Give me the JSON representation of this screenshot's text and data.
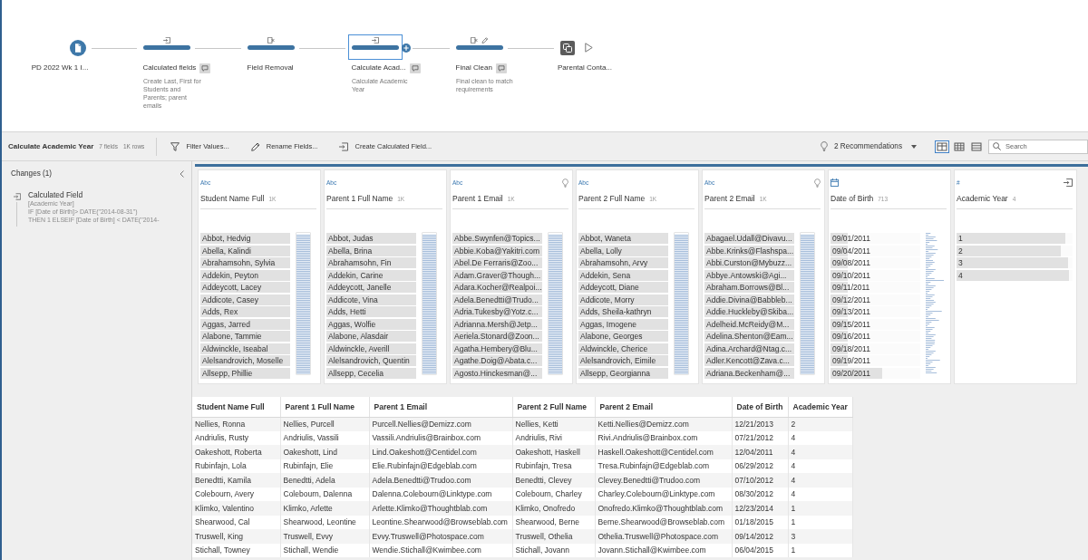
{
  "flow": {
    "nodes": [
      {
        "kind": "input",
        "label": "PD 2022 Wk 1 I...",
        "selected": false,
        "has_comment": false
      },
      {
        "kind": "clean",
        "label": "Calculated fields",
        "change_icons": [
          {
            "kind": "calculation"
          }
        ],
        "selected": false,
        "has_comment": true,
        "description": "Create Last, First for Students and Parents; parent emails"
      },
      {
        "kind": "clean",
        "label": "Field Removal",
        "change_icons": [
          {
            "kind": "remove"
          }
        ],
        "selected": false,
        "has_comment": false
      },
      {
        "kind": "clean",
        "label": "Calculate Acad...",
        "change_icons": [
          {
            "kind": "calculation"
          }
        ],
        "selected": true,
        "has_comment": true,
        "description": "Calculate Academic Year"
      },
      {
        "kind": "clean",
        "label": "Final Clean",
        "change_icons": [
          {
            "kind": "remove"
          },
          {
            "kind": "rename"
          }
        ],
        "selected": false,
        "has_comment": true,
        "description": "Final clean to match requirements"
      },
      {
        "kind": "output",
        "label": "Parental Conta...",
        "selected": false,
        "has_comment": false
      }
    ]
  },
  "toolbar": {
    "title": "Calculate Academic Year",
    "field_count": "7 fields",
    "row_count": "1K rows",
    "actions": [
      {
        "kind": "filter",
        "label": "Filter Values..."
      },
      {
        "kind": "rename",
        "label": "Rename Fields..."
      },
      {
        "kind": "calculation",
        "label": "Create Calculated Field..."
      }
    ],
    "recommendations": "2 Recommendations",
    "view_modes": [
      {
        "kind": "profile",
        "selected": true
      },
      {
        "kind": "table",
        "selected": false
      },
      {
        "kind": "list",
        "selected": false
      }
    ],
    "search": {
      "placeholder": "Search"
    }
  },
  "changes_panel": {
    "title": "Changes (1)",
    "items": [
      {
        "kind": "calculation",
        "title": "Calculated Field",
        "field": "[Academic Year]",
        "formula_lines": [
          "IF [Date of Birth]> DATE(\"2014-08-31\")",
          "THEN 1 ELSEIF [Date of Birth] < DATE(\"2014-"
        ]
      }
    ]
  },
  "profile_cards": [
    {
      "kind": "text",
      "type_label": "Abc",
      "name": "Student Name Full",
      "count": "1K",
      "recommendation": false,
      "calculated": false,
      "values": [
        {
          "label": "Abbot, Hedvig",
          "level": 1
        },
        {
          "label": "Abella, Kalindi",
          "level": 1
        },
        {
          "label": "Abrahamsohn, Sylvia",
          "level": 1
        },
        {
          "label": "Addekin, Peyton",
          "level": 1
        },
        {
          "label": "Addeycott, Lacey",
          "level": 1
        },
        {
          "label": "Addicote, Casey",
          "level": 1
        },
        {
          "label": "Adds, Rex",
          "level": 1
        },
        {
          "label": "Aggas, Jarred",
          "level": 1
        },
        {
          "label": "Alabone, Tammie",
          "level": 1
        },
        {
          "label": "Aldwinckle, Iseabal",
          "level": 1
        },
        {
          "label": "Alelsandrovich, Moselle",
          "level": 1
        },
        {
          "label": "Allsepp, Phillie",
          "level": 1
        }
      ]
    },
    {
      "kind": "text",
      "type_label": "Abc",
      "name": "Parent 1 Full Name",
      "count": "1K",
      "recommendation": false,
      "calculated": false,
      "values": [
        {
          "label": "Abbot, Judas",
          "level": 1
        },
        {
          "label": "Abella, Brina",
          "level": 1
        },
        {
          "label": "Abrahamsohn, Fin",
          "level": 1
        },
        {
          "label": "Addekin, Carine",
          "level": 1
        },
        {
          "label": "Addeycott, Janelle",
          "level": 1
        },
        {
          "label": "Addicote, Vina",
          "level": 1
        },
        {
          "label": "Adds, Hetti",
          "level": 1
        },
        {
          "label": "Aggas, Wolfie",
          "level": 1
        },
        {
          "label": "Alabone, Alasdair",
          "level": 1
        },
        {
          "label": "Aldwinckle, Averill",
          "level": 1
        },
        {
          "label": "Alelsandrovich, Quentin",
          "level": 1
        },
        {
          "label": "Allsepp, Cecelia",
          "level": 1
        }
      ]
    },
    {
      "kind": "text",
      "type_label": "Abc",
      "name": "Parent 1 Email",
      "count": "1K",
      "recommendation": true,
      "calculated": false,
      "values": [
        {
          "label": "Abbe.Swynfen@Topics...",
          "level": 1
        },
        {
          "label": "Abbie.Koba@Yakitri.com",
          "level": 1
        },
        {
          "label": "Abel.De Ferraris@Zoo...",
          "level": 1
        },
        {
          "label": "Adam.Graver@Though...",
          "level": 1
        },
        {
          "label": "Adara.Kocher@Realpoi...",
          "level": 1
        },
        {
          "label": "Adela.Benedtti@Trudo...",
          "level": 1
        },
        {
          "label": "Adria.Tukesby@Yotz.c...",
          "level": 1
        },
        {
          "label": "Adrianna.Mersh@Jetp...",
          "level": 1
        },
        {
          "label": "Aeriela.Stonard@Zoon...",
          "level": 1
        },
        {
          "label": "Agatha.Hembery@Blu...",
          "level": 1
        },
        {
          "label": "Agathe.Doig@Abata.c...",
          "level": 1
        },
        {
          "label": "Agosto.Hinckesman@...",
          "level": 1
        }
      ]
    },
    {
      "kind": "text",
      "type_label": "Abc",
      "name": "Parent 2 Full Name",
      "count": "1K",
      "recommendation": false,
      "calculated": false,
      "values": [
        {
          "label": "Abbot, Waneta",
          "level": 1
        },
        {
          "label": "Abella, Lolly",
          "level": 1
        },
        {
          "label": "Abrahamsohn, Arvy",
          "level": 1
        },
        {
          "label": "Addekin, Sena",
          "level": 1
        },
        {
          "label": "Addeycott, Diane",
          "level": 1
        },
        {
          "label": "Addicote, Morry",
          "level": 1
        },
        {
          "label": "Adds, Sheila-kathryn",
          "level": 1
        },
        {
          "label": "Aggas, Imogene",
          "level": 1
        },
        {
          "label": "Alabone, Georges",
          "level": 1
        },
        {
          "label": "Aldwinckle, Cherice",
          "level": 1
        },
        {
          "label": "Alelsandrovich, Eimile",
          "level": 1
        },
        {
          "label": "Allsepp, Georgianna",
          "level": 1
        }
      ]
    },
    {
      "kind": "text",
      "type_label": "Abc",
      "name": "Parent 2 Email",
      "count": "1K",
      "recommendation": true,
      "calculated": false,
      "values": [
        {
          "label": "Abagael.Udall@Divavu...",
          "level": 1
        },
        {
          "label": "Abbe.Krinks@Flashspa...",
          "level": 1
        },
        {
          "label": "Abbi.Curston@Mybuzz...",
          "level": 1
        },
        {
          "label": "Abbye.Antowski@Agi...",
          "level": 1
        },
        {
          "label": "Abraham.Borrows@Bl...",
          "level": 1
        },
        {
          "label": "Addie.Divina@Babbleb...",
          "level": 1
        },
        {
          "label": "Addie.Huckleby@Skiba...",
          "level": 1
        },
        {
          "label": "Adelheid.McReidy@M...",
          "level": 1
        },
        {
          "label": "Adelina.Shenton@Eam...",
          "level": 1
        },
        {
          "label": "Adina.Archard@Ntag.c...",
          "level": 1
        },
        {
          "label": "Adler.Kencott@Zava.c...",
          "level": 1
        },
        {
          "label": "Adriana.Beckenham@...",
          "level": 1
        }
      ]
    },
    {
      "kind": "date",
      "name": "Date of Birth",
      "count": "713",
      "recommendation": false,
      "calculated": false,
      "values": [
        {
          "label": "09/01/2011",
          "level": 0.19
        },
        {
          "label": "09/04/2011",
          "level": 0.19
        },
        {
          "label": "09/08/2011",
          "level": 0.19
        },
        {
          "label": "09/10/2011",
          "level": 0.19
        },
        {
          "label": "09/11/2011",
          "level": 0.19
        },
        {
          "label": "09/12/2011",
          "level": 0.19
        },
        {
          "label": "09/13/2011",
          "level": 0.19
        },
        {
          "label": "09/15/2011",
          "level": 0.19
        },
        {
          "label": "09/16/2011",
          "level": 0.19
        },
        {
          "label": "09/18/2011",
          "level": 0.19
        },
        {
          "label": "09/19/2011",
          "level": 0.19
        },
        {
          "label": "09/20/2011",
          "level": 0.58
        }
      ]
    },
    {
      "kind": "number",
      "type_label": "#",
      "name": "Academic Year",
      "count": "4",
      "recommendation": false,
      "calculated": true,
      "values": [
        {
          "label": "1",
          "level": 0.94
        },
        {
          "label": "2",
          "level": 0.9
        },
        {
          "label": "3",
          "level": 0.96
        },
        {
          "label": "4",
          "level": 0.97
        }
      ]
    }
  ],
  "data_grid": {
    "columns": [
      "Student Name Full",
      "Parent 1 Full Name",
      "Parent 1 Email",
      "Parent 2 Full Name",
      "Parent 2 Email",
      "Date of Birth",
      "Academic Year"
    ],
    "rows": [
      [
        "Nellies, Ronna",
        "Nellies, Purcell",
        "Purcell.Nellies@Demizz.com",
        "Nellies, Ketti",
        "Ketti.Nellies@Demizz.com",
        "12/21/2013",
        "2"
      ],
      [
        "Andriulis, Rusty",
        "Andriulis, Vassili",
        "Vassili.Andriulis@Brainbox.com",
        "Andriulis, Rivi",
        "Rivi.Andriulis@Brainbox.com",
        "07/21/2012",
        "4"
      ],
      [
        "Oakeshott, Roberta",
        "Oakeshott, Lind",
        "Lind.Oakeshott@Centidel.com",
        "Oakeshott, Haskell",
        "Haskell.Oakeshott@Centidel.com",
        "12/04/2011",
        "4"
      ],
      [
        "Rubinfajn, Lola",
        "Rubinfajn, Elie",
        "Elie.Rubinfajn@Edgeblab.com",
        "Rubinfajn, Tresa",
        "Tresa.Rubinfajn@Edgeblab.com",
        "06/29/2012",
        "4"
      ],
      [
        "Benedtti, Kamila",
        "Benedtti, Adela",
        "Adela.Benedtti@Trudoo.com",
        "Benedtti, Clevey",
        "Clevey.Benedtti@Trudoo.com",
        "07/10/2012",
        "4"
      ],
      [
        "Colebourn, Avery",
        "Colebourn, Dalenna",
        "Dalenna.Colebourn@Linktype.com",
        "Colebourn, Charley",
        "Charley.Colebourn@Linktype.com",
        "08/30/2012",
        "4"
      ],
      [
        "Klimko, Valentino",
        "Klimko, Arlette",
        "Arlette.Klimko@Thoughtblab.com",
        "Klimko, Onofredo",
        "Onofredo.Klimko@Thoughtblab.com",
        "12/23/2014",
        "1"
      ],
      [
        "Shearwood, Cal",
        "Shearwood, Leontine",
        "Leontine.Shearwood@Browseblab.com",
        "Shearwood, Berne",
        "Berne.Shearwood@Browseblab.com",
        "01/18/2015",
        "1"
      ],
      [
        "Truswell, King",
        "Truswell, Evvy",
        "Evvy.Truswell@Photospace.com",
        "Truswell, Othelia",
        "Othelia.Truswell@Photospace.com",
        "09/14/2012",
        "3"
      ],
      [
        "Stichall, Towney",
        "Stichall, Wendie",
        "Wendie.Stichall@Kwimbee.com",
        "Stichall, Jovann",
        "Jovann.Stichall@Kwimbee.com",
        "06/04/2015",
        "1"
      ]
    ]
  }
}
